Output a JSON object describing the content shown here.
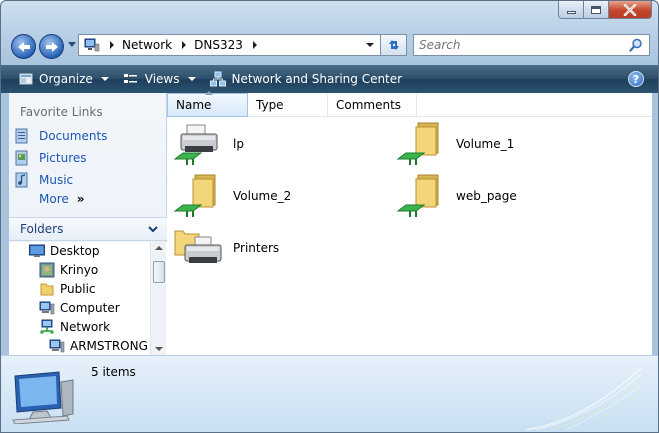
{
  "window": {
    "caption_buttons": [
      "minimize",
      "maximize",
      "close"
    ]
  },
  "address_bar": {
    "segments": [
      "Network",
      "DNS323"
    ],
    "search_placeholder": "Search"
  },
  "command_bar": {
    "organize": "Organize",
    "views": "Views",
    "network_center": "Network and Sharing Center",
    "help": "?"
  },
  "nav_pane": {
    "favorite_links_title": "Favorite Links",
    "favorites": [
      {
        "label": "Documents",
        "icon": "documents-icon"
      },
      {
        "label": "Pictures",
        "icon": "pictures-icon"
      },
      {
        "label": "Music",
        "icon": "music-icon"
      }
    ],
    "more": "More",
    "more_glyph": "»",
    "folders_title": "Folders",
    "tree": [
      {
        "label": "Desktop",
        "icon": "desktop-icon",
        "level": 0
      },
      {
        "label": "Krinyo",
        "icon": "user-folder-icon",
        "level": 1
      },
      {
        "label": "Public",
        "icon": "folder-icon",
        "level": 1
      },
      {
        "label": "Computer",
        "icon": "computer-icon",
        "level": 1
      },
      {
        "label": "Network",
        "icon": "network-icon",
        "level": 1
      },
      {
        "label": "ARMSTRONG",
        "icon": "computer-icon",
        "level": 2
      }
    ]
  },
  "columns": [
    "Name",
    "Type",
    "Comments"
  ],
  "items": [
    {
      "label": "lp",
      "icon": "shared-printer-icon"
    },
    {
      "label": "Volume_1",
      "icon": "shared-folder-icon"
    },
    {
      "label": "Volume_2",
      "icon": "shared-folder-icon"
    },
    {
      "label": "web_page",
      "icon": "shared-folder-icon"
    },
    {
      "label": "Printers",
      "icon": "printers-folder-icon"
    }
  ],
  "details": {
    "count_text": "5 items",
    "icon": "network-device-icon"
  }
}
